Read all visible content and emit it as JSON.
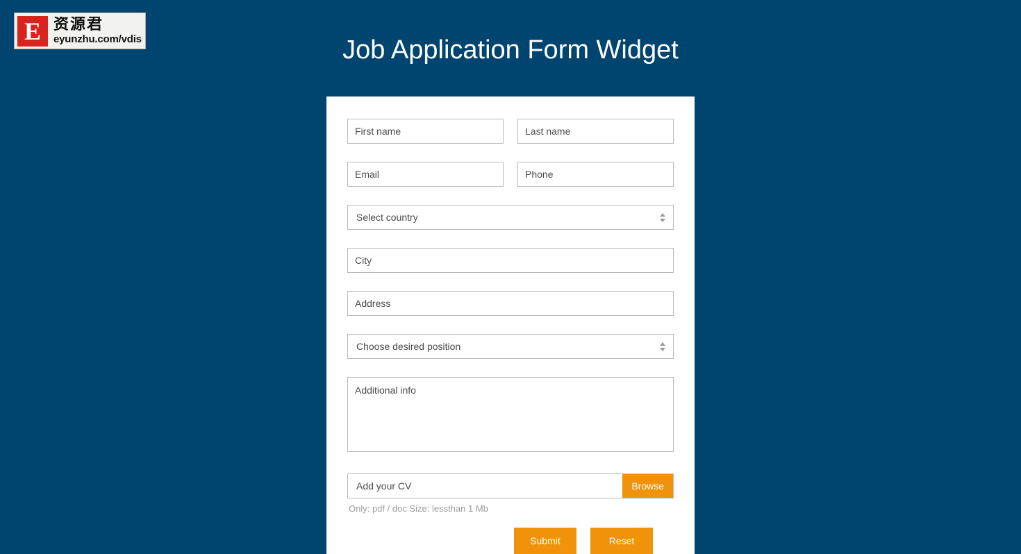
{
  "page": {
    "title": "Job Application Form Widget",
    "background_color": "#00456f",
    "card_background": "#ffffff",
    "accent_color": "#f0920a"
  },
  "watermark": {
    "mark_letter": "E",
    "brand_cn": "资源君",
    "url": "eyunzhu.com/vdisk",
    "mark_color": "#d8231f"
  },
  "form": {
    "first_name": {
      "placeholder": "First name",
      "value": ""
    },
    "last_name": {
      "placeholder": "Last name",
      "value": ""
    },
    "email": {
      "placeholder": "Email",
      "value": ""
    },
    "phone": {
      "placeholder": "Phone",
      "value": ""
    },
    "country": {
      "selected": "Select country"
    },
    "city": {
      "placeholder": "City",
      "value": ""
    },
    "address": {
      "placeholder": "Address",
      "value": ""
    },
    "position": {
      "selected": "Choose desired position"
    },
    "additional_info": {
      "placeholder": "Additional info",
      "value": ""
    },
    "cv": {
      "label": "Add your CV",
      "browse_label": "Browse",
      "hint": "Only: pdf / doc Size: lessthan 1 Mb"
    },
    "actions": {
      "primary_label": "Submit",
      "secondary_label": "Reset"
    }
  }
}
